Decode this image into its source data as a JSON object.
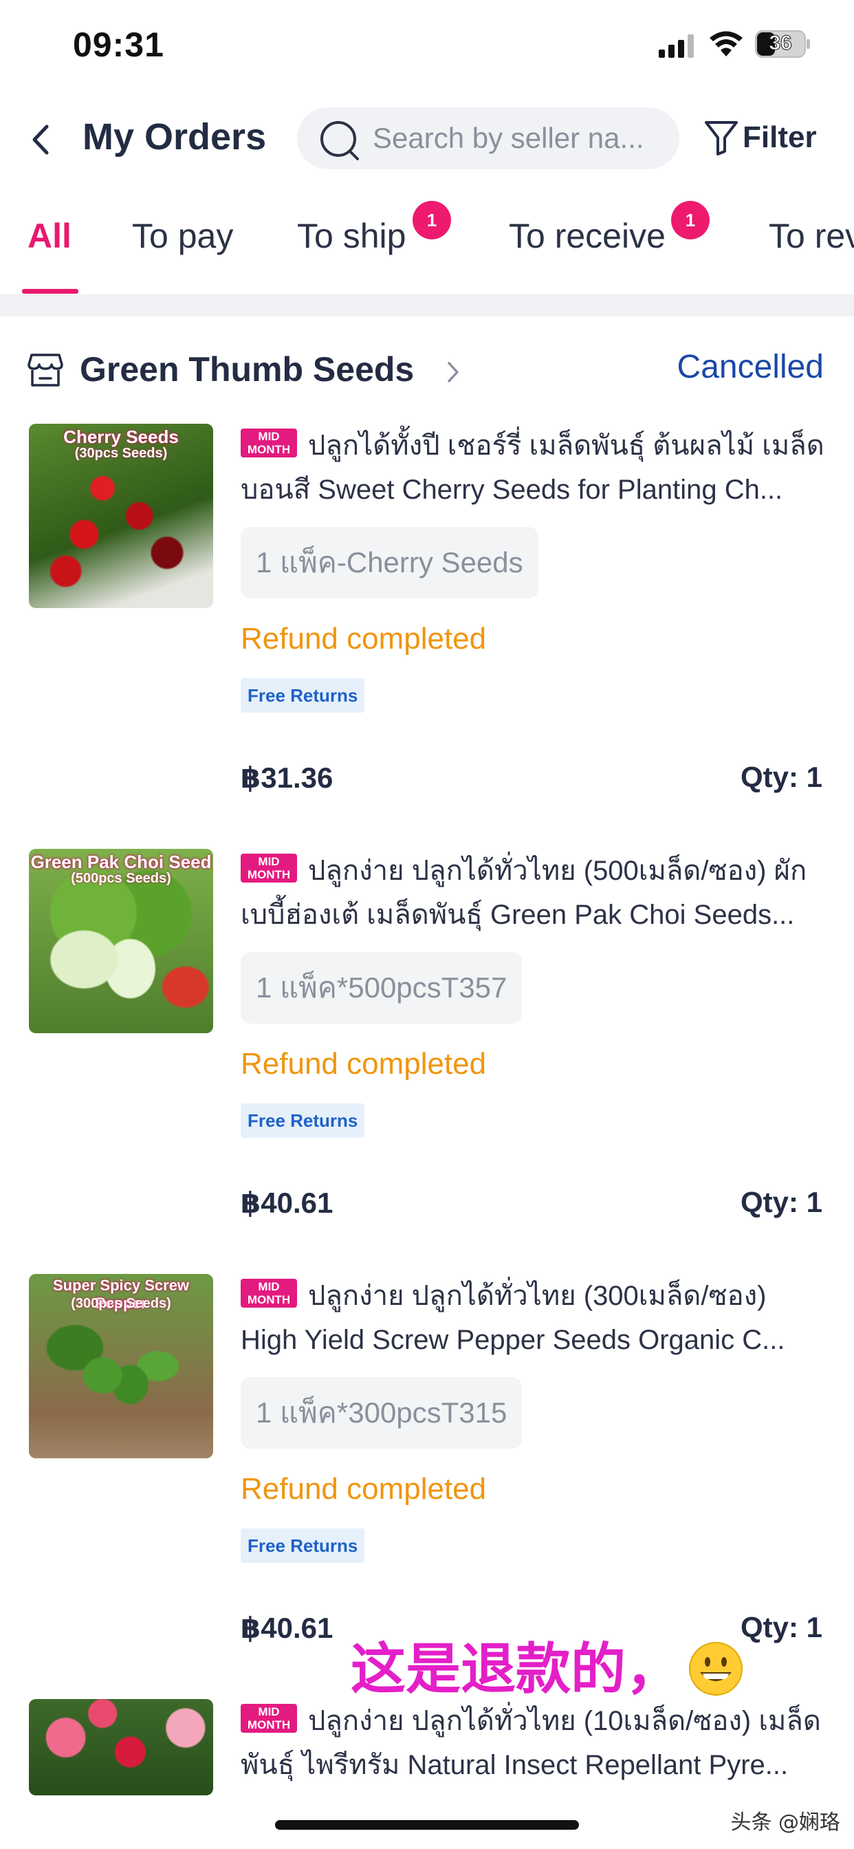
{
  "status_bar": {
    "time": "09:31",
    "battery": "36"
  },
  "header": {
    "title": "My Orders",
    "search_placeholder": "Search by seller na...",
    "filter_label": "Filter"
  },
  "tabs": [
    {
      "label": "All",
      "badge": null,
      "active": true
    },
    {
      "label": "To pay",
      "badge": null,
      "active": false
    },
    {
      "label": "To ship",
      "badge": "1",
      "active": false
    },
    {
      "label": "To receive",
      "badge": "1",
      "active": false
    },
    {
      "label": "To rev",
      "badge": null,
      "active": false
    }
  ],
  "store": {
    "name": "Green Thumb Seeds",
    "status": "Cancelled"
  },
  "orders": [
    {
      "badge": "MID MONTH",
      "title_line1": "ปลูกได้ทั้งปี เชอร์รี่ เมล็ดพันธุ์ ต้นผลไม้ เมล็ด",
      "title_line2": "บอนสี Sweet Cherry Seeds for Planting Ch...",
      "variant": "1 แพ็ค-Cherry Seeds",
      "status": "Refund completed",
      "tag": "Free Returns",
      "price": "฿31.36",
      "qty": "Qty: 1",
      "thumb_caption": "Cherry Seeds",
      "thumb_sub": "(30pcs Seeds)"
    },
    {
      "badge": "MID MONTH",
      "title_line1": "ปลูกง่าย ปลูกได้ทั่วไทย (500เมล็ด/ซอง) ผัก",
      "title_line2": "เบบี้ฮ่องเต้ เมล็ดพันธุ์ Green Pak Choi Seeds...",
      "variant": "1 แพ็ค*500pcsT357",
      "status": "Refund completed",
      "tag": "Free Returns",
      "price": "฿40.61",
      "qty": "Qty: 1",
      "thumb_caption": "Green Pak Choi Seed",
      "thumb_sub": "(500pcs Seeds)"
    },
    {
      "badge": "MID MONTH",
      "title_line1": "ปลูกง่าย ปลูกได้ทั่วไทย (300เมล็ด/ซอง)",
      "title_line2": "High Yield Screw Pepper Seeds Organic C...",
      "variant": "1 แพ็ค*300pcsT315",
      "status": "Refund completed",
      "tag": "Free Returns",
      "price": "฿40.61",
      "qty": "Qty: 1",
      "thumb_caption": "Super Spicy Screw Pepper",
      "thumb_sub": "(300pcs Seeds)"
    },
    {
      "badge": "MID MONTH",
      "title_line1": "ปลูกง่าย ปลูกได้ทั่วไทย (10เมล็ด/ซอง) เมล็ด",
      "title_line2": "พันธุ์ ไพรีทรัม Natural Insect Repellant Pyre...",
      "thumb_caption": "",
      "thumb_sub": ""
    }
  ],
  "annotation": "这是退款的，",
  "watermark": "头条 @娴珞",
  "colors": {
    "accent": "#e8196e",
    "refund": "#f0950f",
    "status_link": "#1a48a8",
    "free_returns": "#1e62c8"
  }
}
